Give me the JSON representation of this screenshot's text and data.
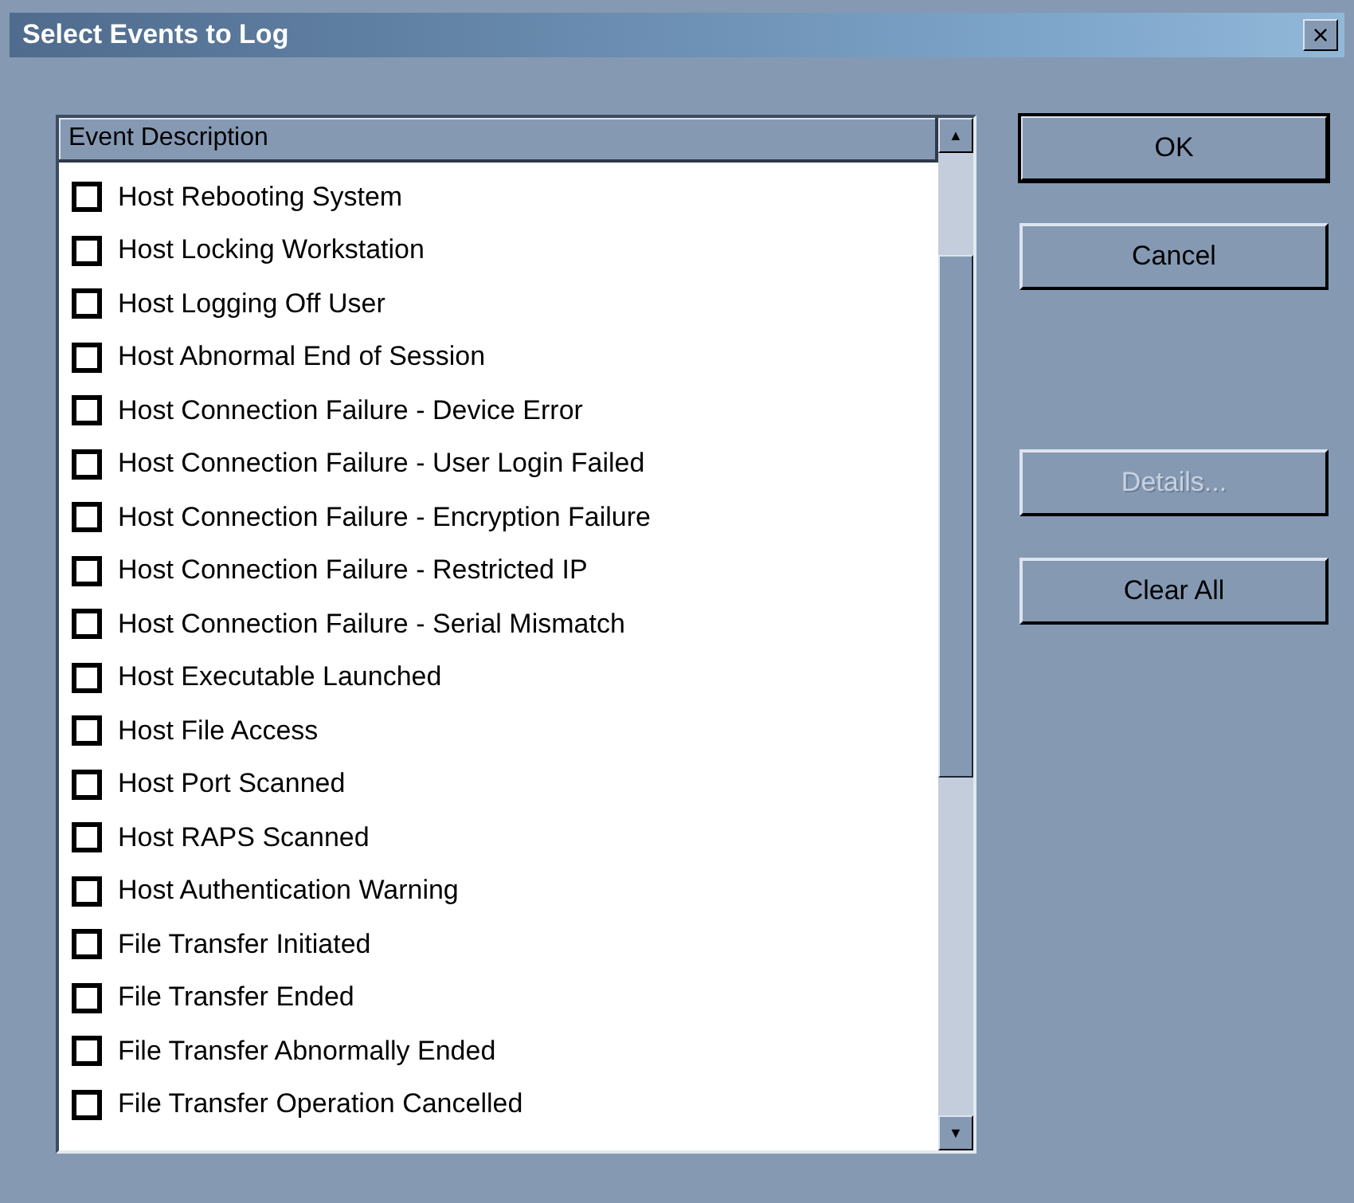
{
  "window": {
    "title": "Select Events to Log",
    "close_glyph": "×"
  },
  "list": {
    "column_header": "Event Description",
    "scroll_up": "▲",
    "scroll_down": "▼",
    "items": [
      {
        "label": "Host Rebooting System",
        "checked": false
      },
      {
        "label": "Host Locking Workstation",
        "checked": false
      },
      {
        "label": "Host Logging Off User",
        "checked": false
      },
      {
        "label": "Host Abnormal End of Session",
        "checked": false
      },
      {
        "label": "Host Connection Failure - Device Error",
        "checked": false
      },
      {
        "label": "Host Connection Failure - User Login Failed",
        "checked": false
      },
      {
        "label": "Host Connection Failure - Encryption Failure",
        "checked": false
      },
      {
        "label": "Host Connection Failure - Restricted IP",
        "checked": false
      },
      {
        "label": "Host Connection Failure - Serial Mismatch",
        "checked": false
      },
      {
        "label": "Host Executable Launched",
        "checked": false
      },
      {
        "label": "Host File Access",
        "checked": false
      },
      {
        "label": "Host Port Scanned",
        "checked": false
      },
      {
        "label": "Host RAPS Scanned",
        "checked": false
      },
      {
        "label": "Host Authentication Warning",
        "checked": false
      },
      {
        "label": "File Transfer Initiated",
        "checked": false
      },
      {
        "label": "File Transfer Ended",
        "checked": false
      },
      {
        "label": "File Transfer Abnormally Ended",
        "checked": false
      },
      {
        "label": "File Transfer Operation Cancelled",
        "checked": false
      }
    ]
  },
  "buttons": [
    {
      "label": "OK",
      "kind": "default",
      "disabled": false
    },
    {
      "label": "Cancel",
      "kind": "normal",
      "disabled": false
    },
    {
      "label": "Details...",
      "kind": "spaced",
      "disabled": true
    },
    {
      "label": "Clear All",
      "kind": "normal",
      "disabled": false
    }
  ]
}
